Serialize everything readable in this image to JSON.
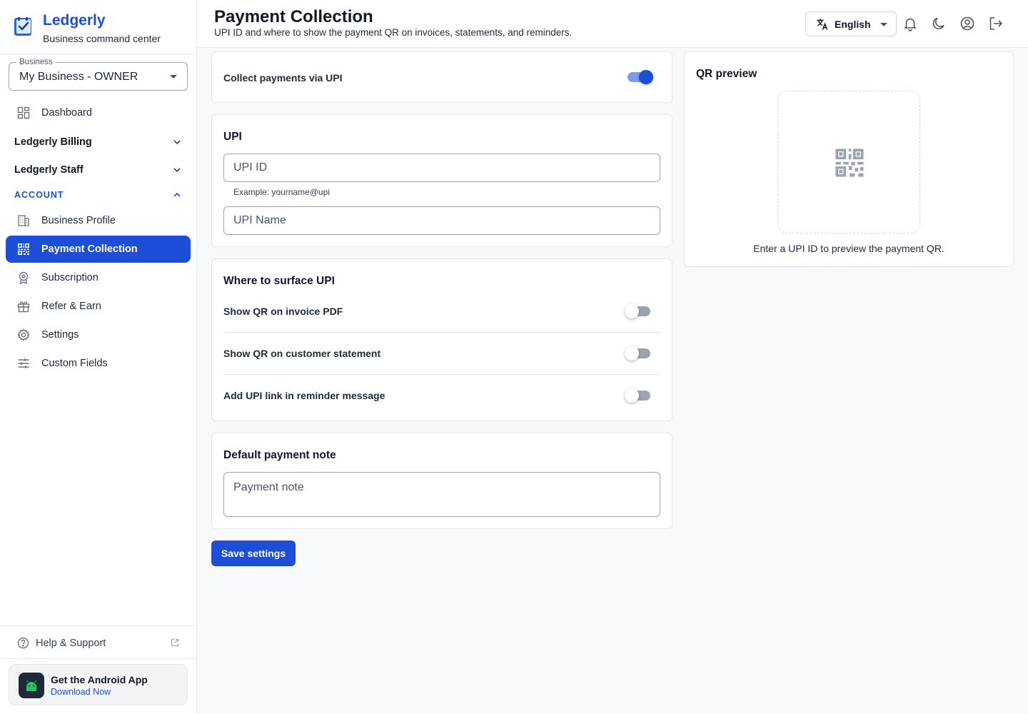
{
  "brand": {
    "name": "Ledgerly",
    "tagline": "Business command center"
  },
  "business_select": {
    "label": "Business",
    "value": "My Business - OWNER"
  },
  "nav": {
    "dashboard": "Dashboard",
    "billing_group": "Ledgerly Billing",
    "staff_group": "Ledgerly Staff",
    "account_section": "ACCOUNT",
    "items": [
      {
        "label": "Business Profile",
        "icon": "building-icon"
      },
      {
        "label": "Payment Collection",
        "icon": "qr-code-icon",
        "active": true
      },
      {
        "label": "Subscription",
        "icon": "award-icon"
      },
      {
        "label": "Refer & Earn",
        "icon": "gift-icon"
      },
      {
        "label": "Settings",
        "icon": "gear-icon"
      },
      {
        "label": "Custom Fields",
        "icon": "sliders-icon"
      }
    ],
    "help": "Help & Support"
  },
  "app_promo": {
    "title": "Get the Android App",
    "link": "Download Now"
  },
  "header": {
    "title": "Payment Collection",
    "subtitle": "UPI ID and where to show the payment QR on invoices, statements, and reminders.",
    "language": "English"
  },
  "collect_card": {
    "label": "Collect payments via UPI",
    "enabled": true
  },
  "upi_card": {
    "title": "UPI",
    "upi_id_placeholder": "UPI ID",
    "upi_id_value": "",
    "upi_id_helper": "Example: yourname@upi",
    "upi_name_placeholder": "UPI Name",
    "upi_name_value": ""
  },
  "surface_card": {
    "title": "Where to surface UPI",
    "options": [
      {
        "label": "Show QR on invoice PDF",
        "enabled": false
      },
      {
        "label": "Show QR on customer statement",
        "enabled": false
      },
      {
        "label": "Add UPI link in reminder message",
        "enabled": false
      }
    ]
  },
  "note_card": {
    "title": "Default payment note",
    "placeholder": "Payment note",
    "value": ""
  },
  "save_label": "Save settings",
  "qr_preview": {
    "title": "QR preview",
    "hint": "Enter a UPI ID to preview the payment QR."
  },
  "colors": {
    "accent": "#1d4ed8",
    "toggle_on_track": "#7c9af0",
    "toggle_off_track": "#9ca3af",
    "border": "#e5e7eb",
    "background": "#f8f9fb"
  }
}
